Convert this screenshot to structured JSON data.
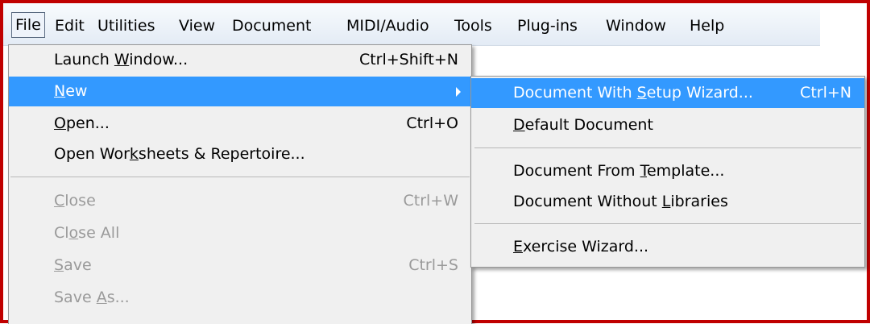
{
  "menubar": {
    "items": [
      {
        "label": "File"
      },
      {
        "label": "Edit"
      },
      {
        "label": "Utilities"
      },
      {
        "label": "View"
      },
      {
        "label": "Document"
      },
      {
        "label": "MIDI/Audio"
      },
      {
        "label": "Tools"
      },
      {
        "label": "Plug-ins"
      },
      {
        "label": "Window"
      },
      {
        "label": "Help"
      }
    ]
  },
  "file_menu": {
    "items": [
      {
        "pre": "Launch ",
        "u": "W",
        "post": "indow...",
        "shortcut": "Ctrl+Shift+N"
      },
      {
        "pre": "",
        "u": "N",
        "post": "ew",
        "shortcut": ""
      },
      {
        "pre": "",
        "u": "O",
        "post": "pen...",
        "shortcut": "Ctrl+O"
      },
      {
        "pre": "Open Wor",
        "u": "k",
        "post": "sheets & Repertoire...",
        "shortcut": ""
      },
      {
        "pre": "",
        "u": "C",
        "post": "lose",
        "shortcut": "Ctrl+W"
      },
      {
        "pre": "Cl",
        "u": "o",
        "post": "se All",
        "shortcut": ""
      },
      {
        "pre": "",
        "u": "S",
        "post": "ave",
        "shortcut": "Ctrl+S"
      },
      {
        "pre": "Save ",
        "u": "A",
        "post": "s...",
        "shortcut": ""
      }
    ]
  },
  "new_submenu": {
    "items": [
      {
        "pre": "Document With ",
        "u": "S",
        "post": "etup Wizard...",
        "shortcut": "Ctrl+N"
      },
      {
        "pre": "",
        "u": "D",
        "post": "efault Document",
        "shortcut": ""
      },
      {
        "pre": "Document From ",
        "u": "T",
        "post": "emplate...",
        "shortcut": ""
      },
      {
        "pre": "Document Without ",
        "u": "L",
        "post": "ibraries",
        "shortcut": ""
      },
      {
        "pre": "",
        "u": "E",
        "post": "xercise Wizard...",
        "shortcut": ""
      }
    ]
  },
  "colors": {
    "highlight": "#3399ff",
    "frame_border": "#c00000",
    "disabled_text": "#9a9a9a",
    "menu_background": "#f0f0f0"
  }
}
